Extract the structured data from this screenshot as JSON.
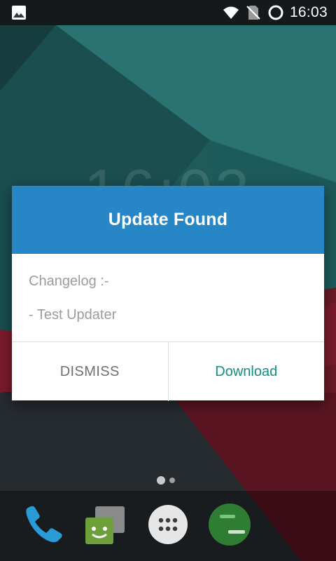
{
  "status_bar": {
    "time": "16:03",
    "icons": [
      "image-notification-icon",
      "wifi-icon",
      "no-sim-icon",
      "battery-ring-icon"
    ]
  },
  "background_clock": "16:03",
  "dialog": {
    "title": "Update Found",
    "changelog_label": "Changelog :-",
    "changelog_entry": "- Test Updater",
    "dismiss_label": "DISMISS",
    "download_label": "Download"
  },
  "dock": {
    "apps": [
      "phone-icon",
      "messaging-icon",
      "app-drawer-icon",
      "hangouts-icon"
    ]
  },
  "colors": {
    "header": "#2786c5",
    "download_text": "#128f82",
    "dismiss_text": "#707070",
    "body_text": "#9c9c9c"
  }
}
